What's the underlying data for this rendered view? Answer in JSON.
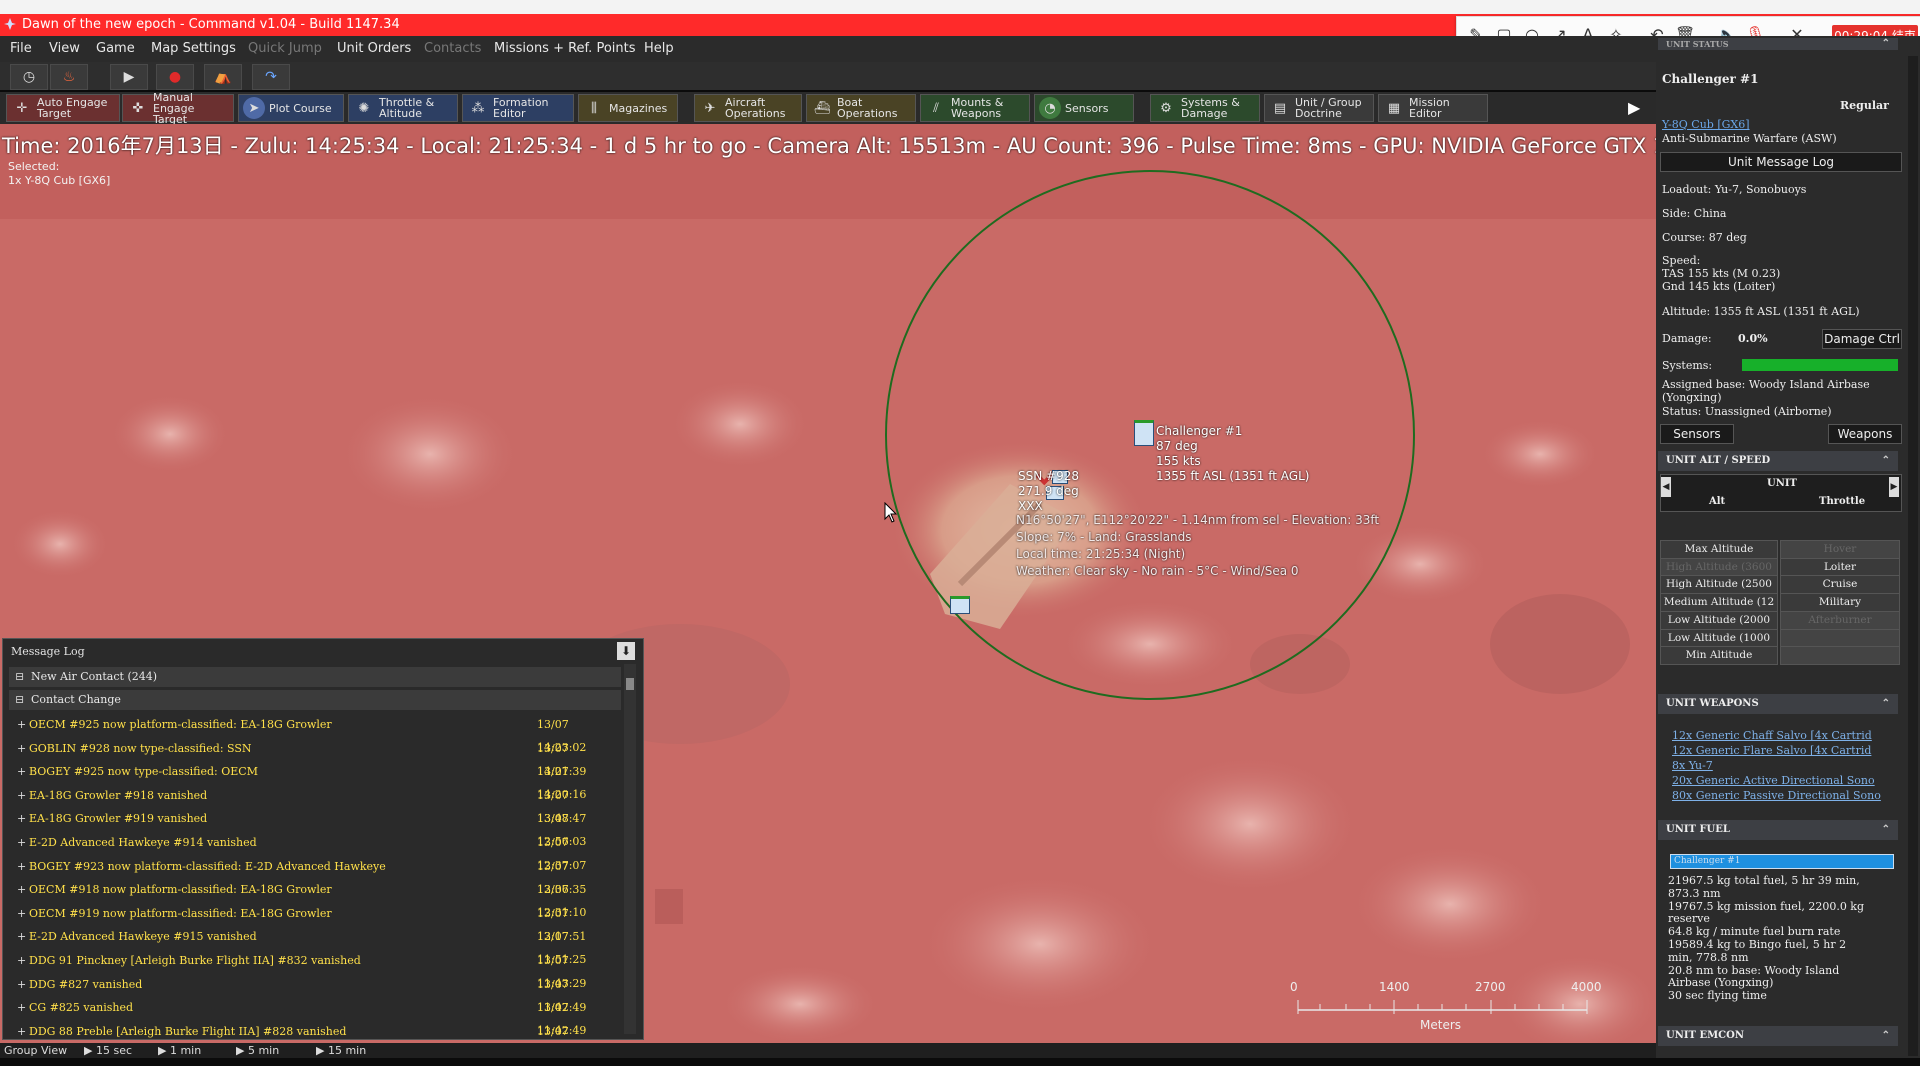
{
  "window": {
    "title": "Dawn of the new epoch - Command v1.04 - Build 1147.34"
  },
  "recorder": {
    "timer": "00:29:04 结束"
  },
  "menu": {
    "items": [
      {
        "label": "File",
        "disabled": false
      },
      {
        "label": "View",
        "disabled": false
      },
      {
        "label": "Game",
        "disabled": false
      },
      {
        "label": "Map Settings",
        "disabled": false
      },
      {
        "label": "Quick Jump",
        "disabled": true
      },
      {
        "label": "Unit Orders",
        "disabled": false
      },
      {
        "label": "Contacts",
        "disabled": true
      },
      {
        "label": "Missions + Ref. Points",
        "disabled": false
      },
      {
        "label": "Help",
        "disabled": false
      }
    ]
  },
  "toolbar": {
    "buttons": [
      {
        "label": "Auto Engage\nTarget",
        "icon": "crosshair-icon",
        "color": "#6b3030"
      },
      {
        "label": "Manual\nEngage Target",
        "icon": "target-icon",
        "color": "#6b3030"
      },
      {
        "label": "Plot Course",
        "icon": "course-icon",
        "color": "#2d3f63"
      },
      {
        "label": "Throttle &\nAltitude",
        "icon": "throttle-icon",
        "color": "#2d3f63"
      },
      {
        "label": "Formation\nEditor",
        "icon": "formation-icon",
        "color": "#2d3f63"
      },
      {
        "label": "Magazines",
        "icon": "magazine-icon",
        "color": "#4a4325"
      },
      {
        "label": "Aircraft\nOperations",
        "icon": "aircraft-icon",
        "color": "#4a4325"
      },
      {
        "label": "Boat\nOperations",
        "icon": "boat-icon",
        "color": "#4a4325"
      },
      {
        "label": "Mounts &\nWeapons",
        "icon": "mounts-icon",
        "color": "#2c4a2c"
      },
      {
        "label": "Sensors",
        "icon": "radar-icon",
        "color": "#2c4a2c"
      },
      {
        "label": "Systems &\nDamage",
        "icon": "gear-icon",
        "color": "#2c4a2c"
      },
      {
        "label": "Unit / Group\nDoctrine",
        "icon": "doctrine-icon",
        "color": "#3a3a3a"
      },
      {
        "label": "Mission\nEditor",
        "icon": "mission-icon",
        "color": "#3a3a3a"
      }
    ]
  },
  "hud": {
    "status": "Time: 2016年7月13日 - Zulu: 14:25:34 - Local: 21:25:34 - 1 d 5 hr to go -  Camera Alt: 15513m  - AU Count: 396 - Pulse Time: 8ms - GPU: NVIDIA GeForce GTX 1050 Ti",
    "selected_label": "Selected:",
    "selected_unit": "1x Y-8Q Cub [GX6]"
  },
  "map": {
    "unit_label": [
      "Challenger #1",
      "87 deg",
      "155 kts",
      "1355 ft ASL (1351 ft AGL)"
    ],
    "contact_label": [
      "SSN #928",
      "271.9 deg",
      "XXX"
    ],
    "cursor_info": [
      "N16°50'27\", E112°20'22\" - 1.14nm from sel - Elevation: 33ft",
      "Slope: 7%  - Land: Grasslands",
      "Local time: 21:25:34 (Night)",
      "Weather: Clear sky - No rain - 5°C - Wind/Sea 0"
    ],
    "scale": {
      "ticks": [
        "0",
        "1400",
        "2700",
        "4000"
      ],
      "unit": "Meters"
    }
  },
  "message_log": {
    "title": "Message Log",
    "groups": [
      {
        "label": "New Air Contact (244)"
      },
      {
        "label": "Contact Change"
      }
    ],
    "messages": [
      {
        "text": "OECM #925 now platform-classified: EA-18G Growler",
        "time": "13/07 14:23:02"
      },
      {
        "text": "GOBLIN #928 now type-classified: SSN",
        "time": "13/07 14:21:39"
      },
      {
        "text": "BOGEY #925 now type-classified: OECM",
        "time": "13/07 14:20:16"
      },
      {
        "text": "EA-18G Growler #918 vanished",
        "time": "13/07 13:48:47"
      },
      {
        "text": "EA-18G Growler #919 vanished",
        "time": "13/07 12:56:03"
      },
      {
        "text": "E-2D Advanced Hawkeye #914 vanished",
        "time": "13/07 12:37:07"
      },
      {
        "text": "BOGEY #923 now platform-classified: E-2D Advanced Hawkeye",
        "time": "13/07 12:36:35"
      },
      {
        "text": "OECM #918 now platform-classified: EA-18G Growler",
        "time": "13/07 12:31:10"
      },
      {
        "text": "OECM #919 now platform-classified: EA-18G Growler",
        "time": "13/07 12:17:51"
      },
      {
        "text": "E-2D Advanced Hawkeye #915 vanished",
        "time": "13/07 11:51:25"
      },
      {
        "text": "DDG 91 Pinckney [Arleigh Burke Flight IIA] #832 vanished",
        "time": "13/07 11:43:29"
      },
      {
        "text": "DDG #827 vanished",
        "time": "13/07 11:42:49"
      },
      {
        "text": "CG #825 vanished",
        "time": "13/07 11:42:49"
      },
      {
        "text": "DDG 88 Preble [Arleigh Burke Flight IIA] #828 vanished",
        "time": "13/07 11:42:49"
      }
    ]
  },
  "bottom_bar": {
    "label": "Group View",
    "steps": [
      "15 sec",
      "1 min",
      "5 min",
      "15 min"
    ]
  },
  "unit_panel": {
    "status_header": "UNIT STATUS",
    "name": "Challenger #1",
    "proficiency": "Regular",
    "type_link": "Y-8Q Cub [GX6]",
    "role": "Anti-Submarine Warfare (ASW)",
    "log_button": "Unit Message Log",
    "loadout": "Loadout: Yu-7, Sonobuoys",
    "side": "Side: China",
    "course": "Course: 87 deg",
    "speed_label": "Speed:",
    "speed_tas": "TAS 155 kts (M 0.23)",
    "speed_gnd": "Gnd 145 kts (Loiter)",
    "altitude": "Altitude: 1355 ft ASL (1351 ft AGL)",
    "damage_label": "Damage:",
    "damage_value": "0.0%",
    "damage_button": "Damage Ctrl",
    "systems_label": "Systems:",
    "systems_health": 1.0,
    "base_1": "Assigned base: Woody Island Airbase",
    "base_2": "(Yongxing)",
    "status": "Status: Unassigned (Airborne)",
    "sensors_button": "Sensors",
    "weapons_button": "Weapons",
    "alt_speed_header": "UNIT ALT / SPEED",
    "alt_speed_sub": "UNIT",
    "alt_col": "Alt",
    "throttle_col": "Throttle",
    "alt_rows": [
      {
        "alt": "Max Altitude",
        "thr": "Hover",
        "alt_dis": false,
        "thr_dis": true
      },
      {
        "alt": "High Altitude (3600",
        "thr": "Loiter",
        "alt_dis": true,
        "thr_dis": false
      },
      {
        "alt": "High Altitude (2500",
        "thr": "Cruise",
        "alt_dis": false,
        "thr_dis": false
      },
      {
        "alt": "Medium Altitude (12",
        "thr": "Military",
        "alt_dis": false,
        "thr_dis": false
      },
      {
        "alt": "Low Altitude (2000",
        "thr": "Afterburner",
        "alt_dis": false,
        "thr_dis": true
      },
      {
        "alt": "Low Altitude (1000",
        "thr": "",
        "alt_dis": false,
        "thr_dis": true
      },
      {
        "alt": "Min Altitude",
        "thr": "",
        "alt_dis": false,
        "thr_dis": true
      }
    ],
    "weapons_header": "UNIT WEAPONS",
    "weapons": [
      "12x Generic Chaff Salvo [4x Cartrid",
      "12x Generic Flare Salvo [4x Cartrid",
      "8x Yu-7",
      "20x Generic Active Directional Sono",
      "80x Generic Passive Directional Sono"
    ],
    "fuel_header": "UNIT FUEL",
    "fuel_unit": "Challenger #1",
    "fuel_lines": [
      "21967.5 kg total fuel, 5 hr 39 min,",
      "873.3 nm",
      "19767.5 kg mission fuel, 2200.0 kg",
      "reserve",
      "64.8 kg / minute fuel burn rate",
      "19589.4 kg to Bingo fuel, 5 hr 2",
      "min, 778.8 nm",
      "20.8 nm to base: Woody Island",
      "Airbase (Yongxing)",
      "30 sec flying time"
    ],
    "emcon_header": "UNIT EMCON"
  }
}
